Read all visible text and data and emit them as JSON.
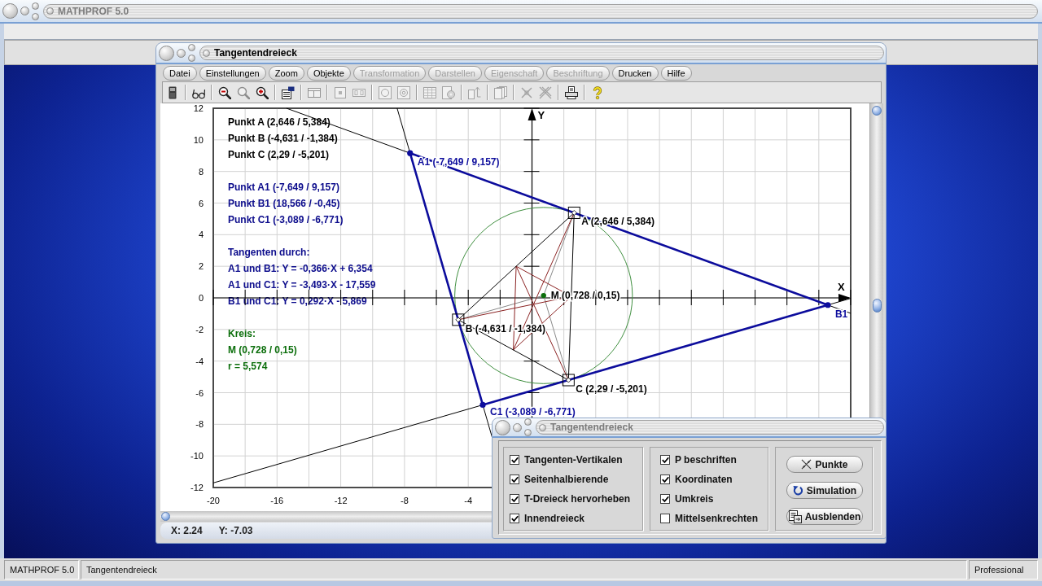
{
  "main_window": {
    "title": "MATHPROF 5.0"
  },
  "graph_window": {
    "title": "Tangentendreieck",
    "menu": [
      {
        "label": "Datei",
        "disabled": false
      },
      {
        "label": "Einstellungen",
        "disabled": false
      },
      {
        "label": "Zoom",
        "disabled": false
      },
      {
        "label": "Objekte",
        "disabled": false
      },
      {
        "label": "Transformation",
        "disabled": true
      },
      {
        "label": "Darstellen",
        "disabled": true
      },
      {
        "label": "Eigenschaft",
        "disabled": true
      },
      {
        "label": "Beschriftung",
        "disabled": true
      },
      {
        "label": "Drucken",
        "disabled": false
      },
      {
        "label": "Hilfe",
        "disabled": false
      }
    ],
    "toolbar": [
      [
        {
          "disabled": false
        }
      ],
      [
        {
          "disabled": false
        }
      ],
      [
        {
          "disabled": false
        },
        {
          "disabled": true
        },
        {
          "disabled": false
        }
      ],
      [
        {
          "disabled": false
        }
      ],
      [
        {
          "disabled": true
        }
      ],
      [
        {
          "disabled": true
        },
        {
          "disabled": true
        }
      ],
      [
        {
          "disabled": true
        },
        {
          "disabled": true
        }
      ],
      [
        {
          "disabled": true
        },
        {
          "disabled": true
        }
      ],
      [
        {
          "disabled": true
        }
      ],
      [
        {
          "disabled": true
        }
      ],
      [
        {
          "disabled": true
        },
        {
          "disabled": true
        }
      ],
      [
        {
          "disabled": false
        }
      ],
      [
        {
          "disabled": false
        }
      ]
    ],
    "plot": {
      "info_text": [
        {
          "color": "#000000",
          "lines": [
            "Punkt A (2,646 / 5,384)",
            "Punkt B (-4,631 / -1,384)",
            "Punkt C (2,29 / -5,201)"
          ]
        },
        {
          "color": "#0c0c8c",
          "lines": [
            "Punkt A1 (-7,649 / 9,157)",
            "Punkt B1 (18,566 / -0,45)",
            "Punkt C1 (-3,089 / -6,771)"
          ]
        },
        {
          "color": "#0c0c8c",
          "lines": [
            "Tangenten durch:",
            "A1 und B1: Y = -0,366·X + 6,354",
            "A1 und C1: Y = -3,493·X - 17,559",
            "B1 und C1: Y = 0,292·X - 5,869"
          ]
        },
        {
          "color": "#0b6e0b",
          "lines": [
            "Kreis:",
            "M (0,728 / 0,15)",
            "r = 5,574"
          ]
        }
      ],
      "chart_data": {
        "type": "scatter",
        "xlabel": "X",
        "ylabel": "Y",
        "xlim": [
          -20,
          20
        ],
        "ylim": [
          -12,
          12
        ],
        "xticks": [
          -20,
          -16,
          -12,
          -8,
          -4
        ],
        "yticks": [
          12,
          10,
          8,
          6,
          4,
          2,
          0,
          -2,
          -4,
          -6,
          -8,
          -10,
          -12
        ],
        "grid": true,
        "series": [
          {
            "color": "#000000",
            "x": [
              2.646,
              -4.631,
              2.29
            ],
            "values": [
              5.384,
              -1.384,
              -5.201
            ]
          },
          {
            "color": "#0c0c9c",
            "x": [
              -7.649,
              18.566,
              -3.089
            ],
            "values": [
              9.157,
              -0.45,
              -6.771
            ]
          },
          {
            "color": "#0b6e0b",
            "x": [
              0.728
            ],
            "values": [
              0.15
            ]
          }
        ],
        "annotations": [
          {
            "x": 2.646,
            "y": 5.384,
            "text": "A (2,646 / 5,384)"
          },
          {
            "x": -4.631,
            "y": -1.384,
            "text": "B (-4,631 / -1,384)"
          },
          {
            "x": 2.29,
            "y": -5.201,
            "text": "C (2,29 / -5,201)"
          },
          {
            "x": -7.649,
            "y": 9.157,
            "text": "A1 (-7,649 / 9,157)"
          },
          {
            "x": 18.566,
            "y": -0.45,
            "text": "B1"
          },
          {
            "x": -3.089,
            "y": -6.771,
            "text": "C1 (-3,089 / -6,771)"
          },
          {
            "x": 0.728,
            "y": 0.15,
            "text": "M (0,728 / 0,15)"
          }
        ]
      }
    },
    "status": {
      "cursor_x": "X: 2.24",
      "cursor_y": "Y: -7.03"
    }
  },
  "dialog": {
    "title": "Tangentendreieck",
    "checkbox_groups": [
      [
        {
          "label": "Tangenten-Vertikalen",
          "checked": true
        },
        {
          "label": "Seitenhalbierende",
          "checked": true
        },
        {
          "label": "T-Dreieck hervorheben",
          "checked": true
        },
        {
          "label": "Innendreieck",
          "checked": true
        }
      ],
      [
        {
          "label": "P beschriften",
          "checked": true
        },
        {
          "label": "Koordinaten",
          "checked": true
        },
        {
          "label": "Umkreis",
          "checked": true
        },
        {
          "label": "Mittelsenkrechten",
          "checked": false
        }
      ]
    ],
    "buttons": [
      {
        "label": "Punkte"
      },
      {
        "label": "Simulation"
      },
      {
        "label": "Ausblenden"
      }
    ]
  },
  "status_bar": [
    "MATHPROF 5.0",
    "Tangentendreieck",
    "Professional"
  ]
}
